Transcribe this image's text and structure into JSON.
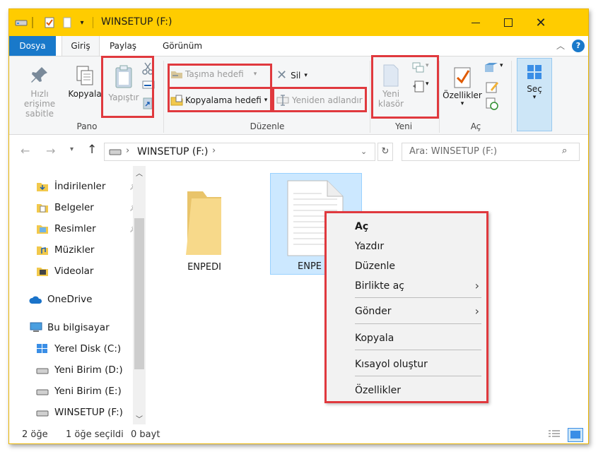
{
  "window": {
    "title": "WINSETUP (F:)"
  },
  "tabs": [
    {
      "label": "Dosya"
    },
    {
      "label": "Giriş"
    },
    {
      "label": "Paylaş"
    },
    {
      "label": "Görünüm"
    }
  ],
  "ribbon": {
    "pano": {
      "label": "Pano",
      "pin_label_1": "Hızlı erişime",
      "pin_label_2": "sabitle",
      "copy": "Kopyala",
      "paste": "Yapıştır"
    },
    "duzenle": {
      "label": "Düzenle",
      "move_to": "Taşıma hedefi",
      "copy_to": "Kopyalama hedefi",
      "delete": "Sil",
      "rename": "Yeniden adlandır"
    },
    "yeni": {
      "label": "Yeni",
      "new_folder_1": "Yeni",
      "new_folder_2": "klasör"
    },
    "ac": {
      "label": "Aç",
      "properties": "Özellikler"
    },
    "sec": {
      "label": "Seç"
    }
  },
  "address": {
    "path": "WINSETUP (F:)",
    "search_placeholder": "Ara: WINSETUP (F:)"
  },
  "sidebar": {
    "items": [
      {
        "label": "İndirilenler"
      },
      {
        "label": "Belgeler"
      },
      {
        "label": "Resimler"
      },
      {
        "label": "Müzikler"
      },
      {
        "label": "Videolar"
      },
      {
        "label": "OneDrive"
      },
      {
        "label": "Bu bilgisayar"
      },
      {
        "label": "Yerel Disk (C:)"
      },
      {
        "label": "Yeni Birim (D:)"
      },
      {
        "label": "Yeni Birim (E:)"
      },
      {
        "label": "WINSETUP (F:)"
      }
    ]
  },
  "files": [
    {
      "name": "ENPEDI"
    },
    {
      "name": "ENPE"
    }
  ],
  "context_menu": {
    "items": [
      {
        "label": "Aç"
      },
      {
        "label": "Yazdır"
      },
      {
        "label": "Düzenle"
      },
      {
        "label": "Birlikte aç"
      },
      {
        "label": "Gönder"
      },
      {
        "label": "Kopyala"
      },
      {
        "label": "Kısayol oluştur"
      },
      {
        "label": "Özellikler"
      }
    ]
  },
  "status": {
    "count": "2 öğe",
    "selected": "1 öğe seçildi",
    "size": "0 bayt"
  },
  "colors": {
    "titlebar": "#ffcc00",
    "file_tab": "#1979ca",
    "highlight": "#e0393e",
    "selection": "#cce8ff"
  }
}
